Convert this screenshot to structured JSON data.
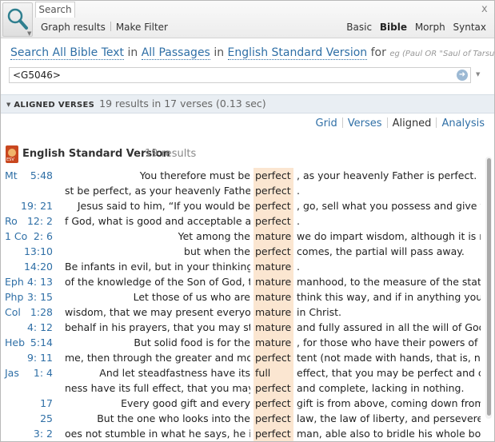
{
  "toolbar": {
    "tab_label": "Search",
    "close": "x",
    "graph_results": "Graph results",
    "make_filter": "Make Filter",
    "modes": [
      "Basic",
      "Bible",
      "Morph",
      "Syntax"
    ]
  },
  "query": {
    "search": "Search All Bible Text",
    "in1": "in",
    "passages": "All Passages",
    "in2": "in",
    "version": "English Standard Version",
    "for": "for",
    "hint": "eg (Paul OR \"Saul of Tarsus\") AND grace",
    "value": "<G5046>"
  },
  "bar": {
    "title": "ALIGNED VERSES",
    "summary": "19 results in 17 verses (0.13 sec)"
  },
  "views": [
    "Grid",
    "Verses",
    "Aligned",
    "Analysis"
  ],
  "version_header": {
    "icon_text": "ESV",
    "title": "English Standard Version",
    "count": "19 results"
  },
  "rows": [
    {
      "book": "Mt",
      "ref": "5:48",
      "pre": "You therefore must be",
      "kw": "perfect",
      "post": ", as your heavenly Father is perfect."
    },
    {
      "book": "",
      "ref": "",
      "pre": "st be perfect, as your heavenly Father is",
      "kw": "perfect",
      "post": "."
    },
    {
      "book": "",
      "ref": "19: 21",
      "pre": "Jesus said to him, “If you would be",
      "kw": "perfect",
      "post": ", go, sell what you possess and give to th"
    },
    {
      "book": "Ro",
      "ref": "12: 2",
      "pre": "f God, what is good and acceptable and",
      "kw": "perfect",
      "post": "."
    },
    {
      "book": "1 Co",
      "ref": "2: 6",
      "pre": "Yet among the",
      "kw": "mature",
      "post": "we do impart wisdom, although it is not"
    },
    {
      "book": "",
      "ref": "13:10",
      "pre": "but when the",
      "kw": "perfect",
      "post": "comes, the partial will pass away."
    },
    {
      "book": "",
      "ref": "14:20",
      "pre": "Be infants in evil, but in your thinking be",
      "kw": "mature",
      "post": "."
    },
    {
      "book": "Eph",
      "ref": "4: 13",
      "pre": "of the knowledge of the Son of God, to",
      "kw": "mature",
      "post": "manhood, to the measure of the statur"
    },
    {
      "book": "Php",
      "ref": "3: 15",
      "pre": "Let those of us who are",
      "kw": "mature",
      "post": "think this way, and if in anything you th"
    },
    {
      "book": "Col",
      "ref": "1:28",
      "pre": "wisdom, that we may present everyone",
      "kw": "mature",
      "post": "in Christ."
    },
    {
      "book": "",
      "ref": "4: 12",
      "pre": "behalf in his prayers, that you may stand",
      "kw": "mature",
      "post": "and fully assured in all the will of God."
    },
    {
      "book": "Heb",
      "ref": "5:14",
      "pre": "But solid food is for the",
      "kw": "mature",
      "post": ", for those who have their powers of dis"
    },
    {
      "book": "",
      "ref": "9: 11",
      "pre": "me, then through the greater and more",
      "kw": "perfect",
      "post": "tent (not made with hands, that is, not"
    },
    {
      "book": "Jas",
      "ref": "1: 4",
      "pre": "And let steadfastness have its",
      "kw": "full",
      "post": "effect, that you may be perfect and com"
    },
    {
      "book": "",
      "ref": "",
      "pre": "ness have its full effect, that you may be",
      "kw": "perfect",
      "post": "and complete, lacking in nothing."
    },
    {
      "book": "",
      "ref": "17",
      "pre": "Every good gift and every",
      "kw": "perfect",
      "post": "gift is from above, coming down from th"
    },
    {
      "book": "",
      "ref": "25",
      "pre": "But the one who looks into the",
      "kw": "perfect",
      "post": "law, the law of liberty, and perseveres,"
    },
    {
      "book": "",
      "ref": "3: 2",
      "pre": "oes not stumble in what he says, he is a",
      "kw": "perfect",
      "post": "man, able also to bridle his whole body"
    }
  ]
}
